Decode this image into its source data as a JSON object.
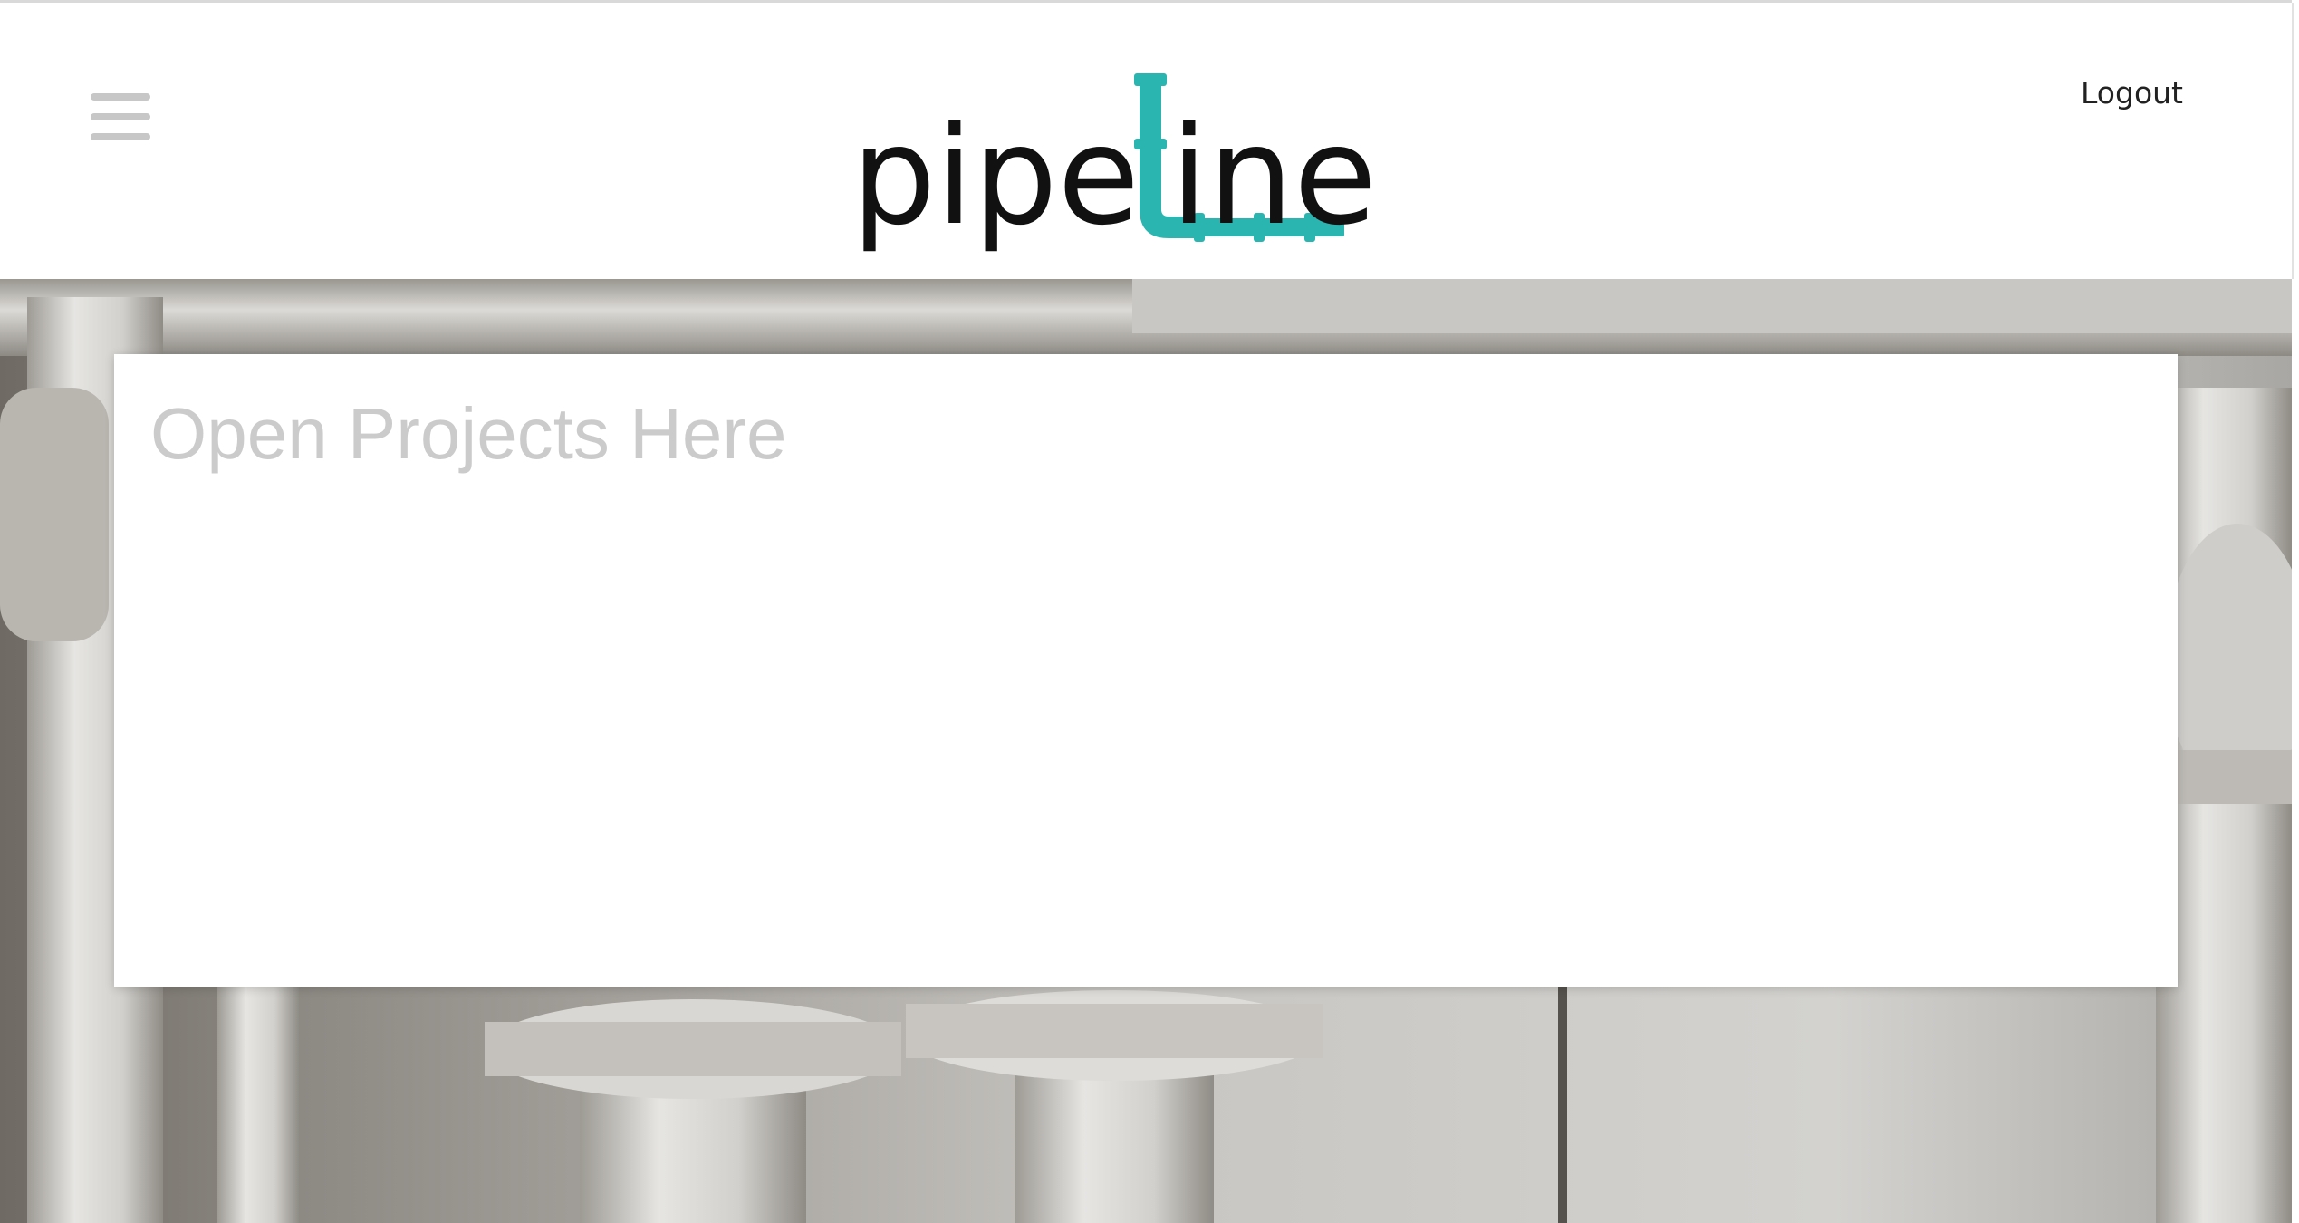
{
  "header": {
    "menu_icon": "hamburger-menu-icon",
    "logo": {
      "text_before": "pipe",
      "text_after": "ine",
      "pipe_letter_color": "#2bb5b0",
      "text_color": "#111111"
    },
    "logout_label": "Logout"
  },
  "hero": {
    "background": "industrial-pipes-photo"
  },
  "projects_panel": {
    "title": "Open Projects Here"
  },
  "colors": {
    "accent": "#2bb5b0",
    "menu_icon": "#c7c7c7",
    "placeholder_text": "#cbcbcb"
  }
}
